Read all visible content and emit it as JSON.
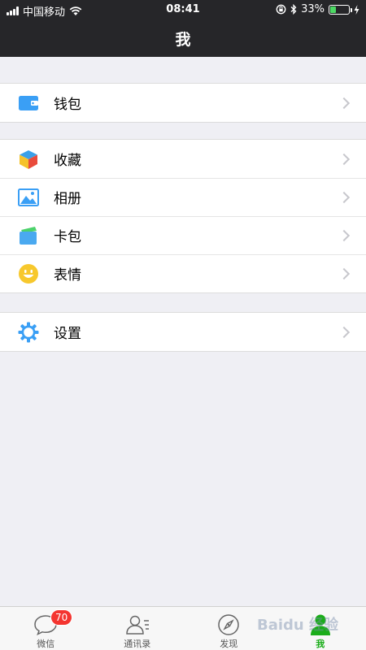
{
  "status_bar": {
    "carrier": "中国移动",
    "time": "08:41",
    "battery_percent": "33%",
    "battery_level": 0.33,
    "icons": [
      "signal-icon",
      "wifi-icon",
      "rotation-lock-icon",
      "bluetooth-icon",
      "battery-icon",
      "charging-icon"
    ]
  },
  "nav": {
    "title": "我"
  },
  "groups": [
    {
      "items": [
        {
          "label": "钱包",
          "icon": "wallet-icon"
        }
      ]
    },
    {
      "items": [
        {
          "label": "收藏",
          "icon": "favorites-cube-icon"
        },
        {
          "label": "相册",
          "icon": "album-icon"
        },
        {
          "label": "卡包",
          "icon": "card-icon"
        },
        {
          "label": "表情",
          "icon": "emoji-icon"
        }
      ]
    },
    {
      "items": [
        {
          "label": "设置",
          "icon": "settings-gear-icon"
        }
      ]
    }
  ],
  "tabbar": {
    "tabs": [
      {
        "label": "微信",
        "icon": "chat-icon",
        "badge": "70"
      },
      {
        "label": "通讯录",
        "icon": "contacts-icon"
      },
      {
        "label": "发现",
        "icon": "compass-icon"
      },
      {
        "label": "我",
        "icon": "me-icon",
        "active": true
      }
    ]
  },
  "watermark": "Baidu 经验",
  "colors": {
    "accent_green": "#1aad19",
    "nav_bg": "#262629",
    "badge_red": "#f43530",
    "page_bg": "#efeff4"
  }
}
